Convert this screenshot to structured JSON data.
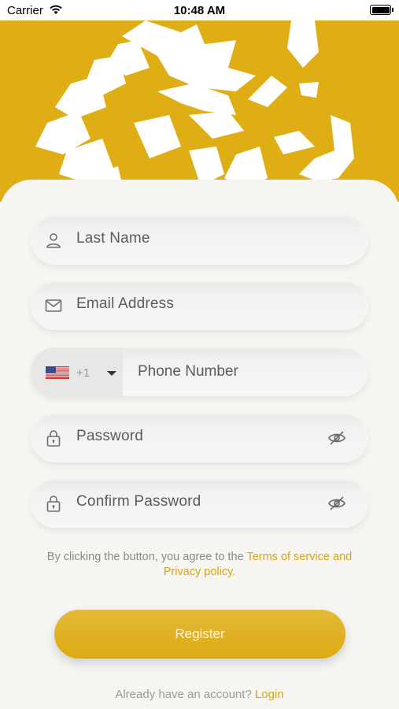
{
  "status_bar": {
    "carrier": "Carrier",
    "time": "10:48 AM"
  },
  "colors": {
    "brand": "#deae14",
    "link": "#d7a516",
    "card_bg": "#f6f5f2"
  },
  "form": {
    "last_name_placeholder": "Last Name",
    "email_placeholder": "Email Address",
    "phone": {
      "country_flag": "us-flag-icon",
      "code": "+1",
      "placeholder": "Phone Number"
    },
    "password_placeholder": "Password",
    "confirm_password_placeholder": "Confirm Password"
  },
  "terms": {
    "prefix": "By clicking the button, you agree to the ",
    "link_text": "Terms of service and Privacy policy."
  },
  "register_label": "Register",
  "login": {
    "prompt": "Already have an account? ",
    "link_text": "Login"
  }
}
